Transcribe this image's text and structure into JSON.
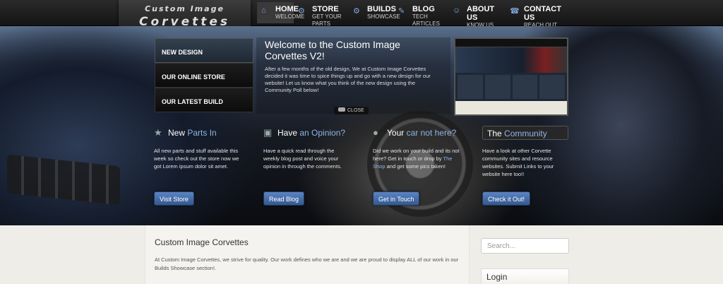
{
  "brand": {
    "line1": "Custom Image",
    "line2": "Corvettes"
  },
  "nav": [
    {
      "icon": "home-icon",
      "title": "HOME",
      "sub": "WELCOME"
    },
    {
      "icon": "store-icon",
      "title": "STORE",
      "sub": "GET YOUR PARTS"
    },
    {
      "icon": "builds-icon",
      "title": "BUILDS",
      "sub": "SHOWCASE"
    },
    {
      "icon": "blog-icon",
      "title": "BLOG",
      "sub": "TECH ARTICLES"
    },
    {
      "icon": "about-icon",
      "title": "ABOUT US",
      "sub": "KNOW US BETTER"
    },
    {
      "icon": "contact-icon",
      "title": "CONTACT US",
      "sub": "REACH OUT"
    }
  ],
  "slider": {
    "tabs": [
      "NEW DESIGN",
      "OUR ONLINE STORE",
      "OUR LATEST BUILD"
    ],
    "title": "Welcome to the Custom Image Corvettes V2!",
    "body": "After a few months of the old design, We at Custom Image Corvettes decided it was time to spice things up and go with a new design for our website! Let us know what you think of the new design using the Community Poll below!",
    "close_label": "CLOSE"
  },
  "features": [
    {
      "title_a": "New",
      "title_b": "Parts In",
      "icon": "star-icon",
      "body": "All new parts and stuff available this week so check out the store now we got Lorem ipsum dolor sit amet.",
      "button": "Visit Store"
    },
    {
      "title_a": "Have",
      "title_b": "an Opinion?",
      "icon": "chat-icon",
      "body": "Have a quick read through the weekly blog post and voice your opinion in through the comments.",
      "button": "Read Blog"
    },
    {
      "title_a": "Your",
      "title_b": "car not here?",
      "icon": "location-pin-icon",
      "body_a": "Did we work on your build and its not here? Get in touch or drop by",
      "body_link": "The Shop",
      "body_b": "and get some pics taken!",
      "button": "Get in Touch"
    },
    {
      "title_a": "The",
      "title_b": "Community",
      "icon": "",
      "body": "Have a look at other Corvette community sites and resource websites. Submit Links to your website here too!!",
      "button": "Check it Out!"
    }
  ],
  "content": {
    "heading": "Custom Image Corvettes",
    "text": "At Custom Image Corvettes, we strive for quality. Our work defines who we are and we are proud to display ALL of our work in our Builds Showcase section!."
  },
  "sidebar": {
    "search_placeholder": "Search...",
    "login_title": "Login"
  },
  "colors": {
    "accent": "#8fb4e6",
    "button": "#4a73b0",
    "page_bg": "#efede8"
  }
}
